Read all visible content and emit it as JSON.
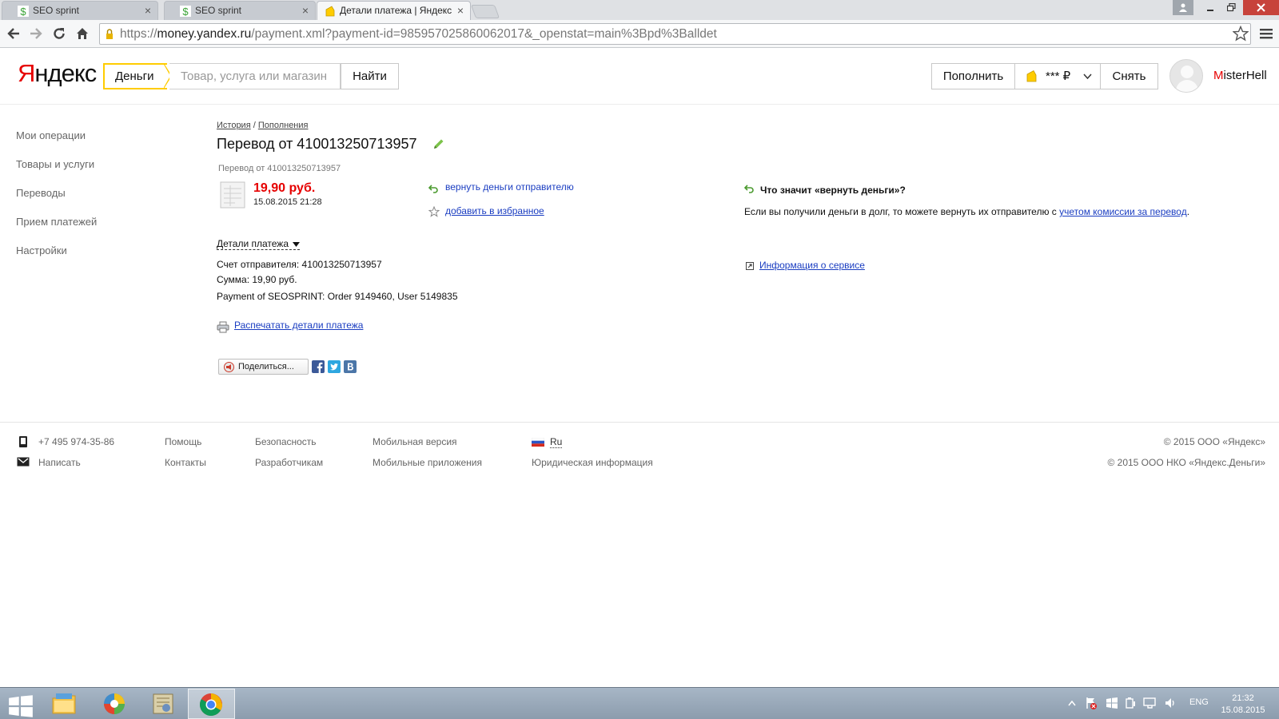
{
  "browser": {
    "tabs": [
      {
        "title": "SEO sprint",
        "active": false
      },
      {
        "title": "SEO sprint",
        "active": false
      },
      {
        "title": "Детали платежа | Яндекс",
        "active": true
      }
    ],
    "url_prefix": "https://",
    "url_host": "money.yandex.ru",
    "url_path": "/payment.xml?payment-id=985957025860062017&_openstat=main%3Bpd%3Balldet",
    "close_glyph": "×"
  },
  "header": {
    "logo_first": "Я",
    "logo_rest": "ндекс",
    "service_tab": "Деньги",
    "search_placeholder": "Товар, услуга или магазин",
    "search_button": "Найти",
    "topup_button": "Пополнить",
    "balance": "*** ₽",
    "withdraw_button": "Снять",
    "username_first": "M",
    "username_rest": "isterHell"
  },
  "sidebar": {
    "items": [
      "Мои операции",
      "Товары и услуги",
      "Переводы",
      "Прием платежей",
      "Настройки"
    ]
  },
  "main": {
    "breadcrumb_history": "История",
    "breadcrumb_sep": " / ",
    "breadcrumb_topups": "Пополнения",
    "title": "Перевод от 410013250713957",
    "subtitle": "Перевод от 410013250713957",
    "amount": "19,90 руб.",
    "datetime": "15.08.2015 21:28",
    "return_money": "вернуть деньги отправителю",
    "add_favorite": "добавить в избранное",
    "details_toggle": "Детали платежа",
    "detail_sender": "Счет отправителя: 410013250713957",
    "detail_sum": "Сумма: 19,90 руб.",
    "detail_comment": "Payment of SEOSPRINT: Order 9149460, User 5149835",
    "print_link": "Распечатать детали платежа",
    "share_button": "Поделиться..."
  },
  "info": {
    "heading": "Что значит «вернуть деньги»?",
    "text": "Если вы получили деньги в долг, то можете вернуть их отправителю с ",
    "text_link": "учетом комиссии за перевод",
    "text_end": ".",
    "service_info": "Информация о сервисе"
  },
  "footer": {
    "phone": "+7 495 974-35-86",
    "write": "Написать",
    "help": "Помощь",
    "contacts": "Контакты",
    "security": "Безопасность",
    "developers": "Разработчикам",
    "mobile_version": "Мобильная версия",
    "mobile_apps": "Мобильные приложения",
    "language": "Ru",
    "legal": "Юридическая информация",
    "copyright1": "© 2015 ООО «Яндекс»",
    "copyright2": "© 2015 ООО НКО «Яндекс.Деньги»"
  },
  "taskbar": {
    "language": "ENG",
    "time": "21:32",
    "date": "15.08.2015"
  },
  "colors": {
    "accent_yellow": "#ffcc00",
    "amount_red": "#e60000",
    "link_blue": "#1a3dc1"
  }
}
